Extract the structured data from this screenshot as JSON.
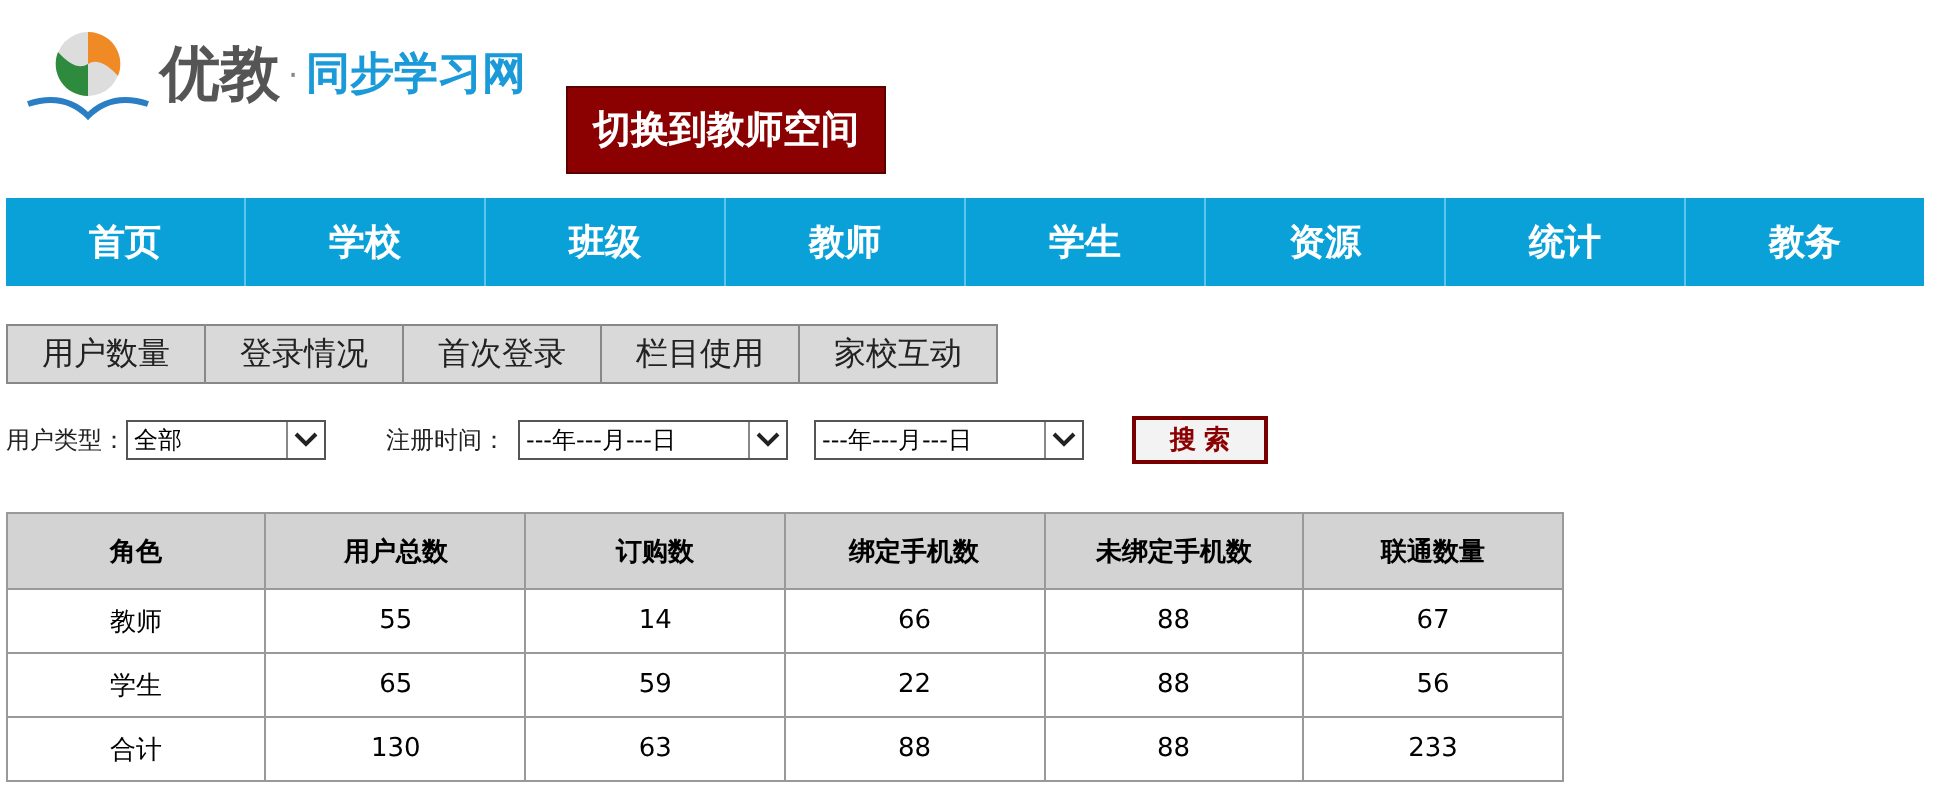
{
  "logo": {
    "primary": "优教",
    "separator": "·",
    "secondary": "同步学习网"
  },
  "switch_button": "切换到教师空间",
  "nav": [
    "首页",
    "学校",
    "班级",
    "教师",
    "学生",
    "资源",
    "统计",
    "教务"
  ],
  "tabs": [
    "用户数量",
    "登录情况",
    "首次登录",
    "栏目使用",
    "家校互动"
  ],
  "filters": {
    "user_type_label": "用户类型：",
    "user_type_value": "全部",
    "register_time_label": "注册时间：",
    "date_from": "---年---月---日",
    "date_to": "---年---月---日",
    "search_button": "搜 索"
  },
  "table": {
    "columns": [
      "角色",
      "用户总数",
      "订购数",
      "绑定手机数",
      "未绑定手机数",
      "联通数量"
    ],
    "rows": [
      [
        "教师",
        "55",
        "14",
        "66",
        "88",
        "67"
      ],
      [
        "学生",
        "65",
        "59",
        "22",
        "88",
        "56"
      ],
      [
        "合计",
        "130",
        "63",
        "88",
        "88",
        "233"
      ]
    ]
  }
}
